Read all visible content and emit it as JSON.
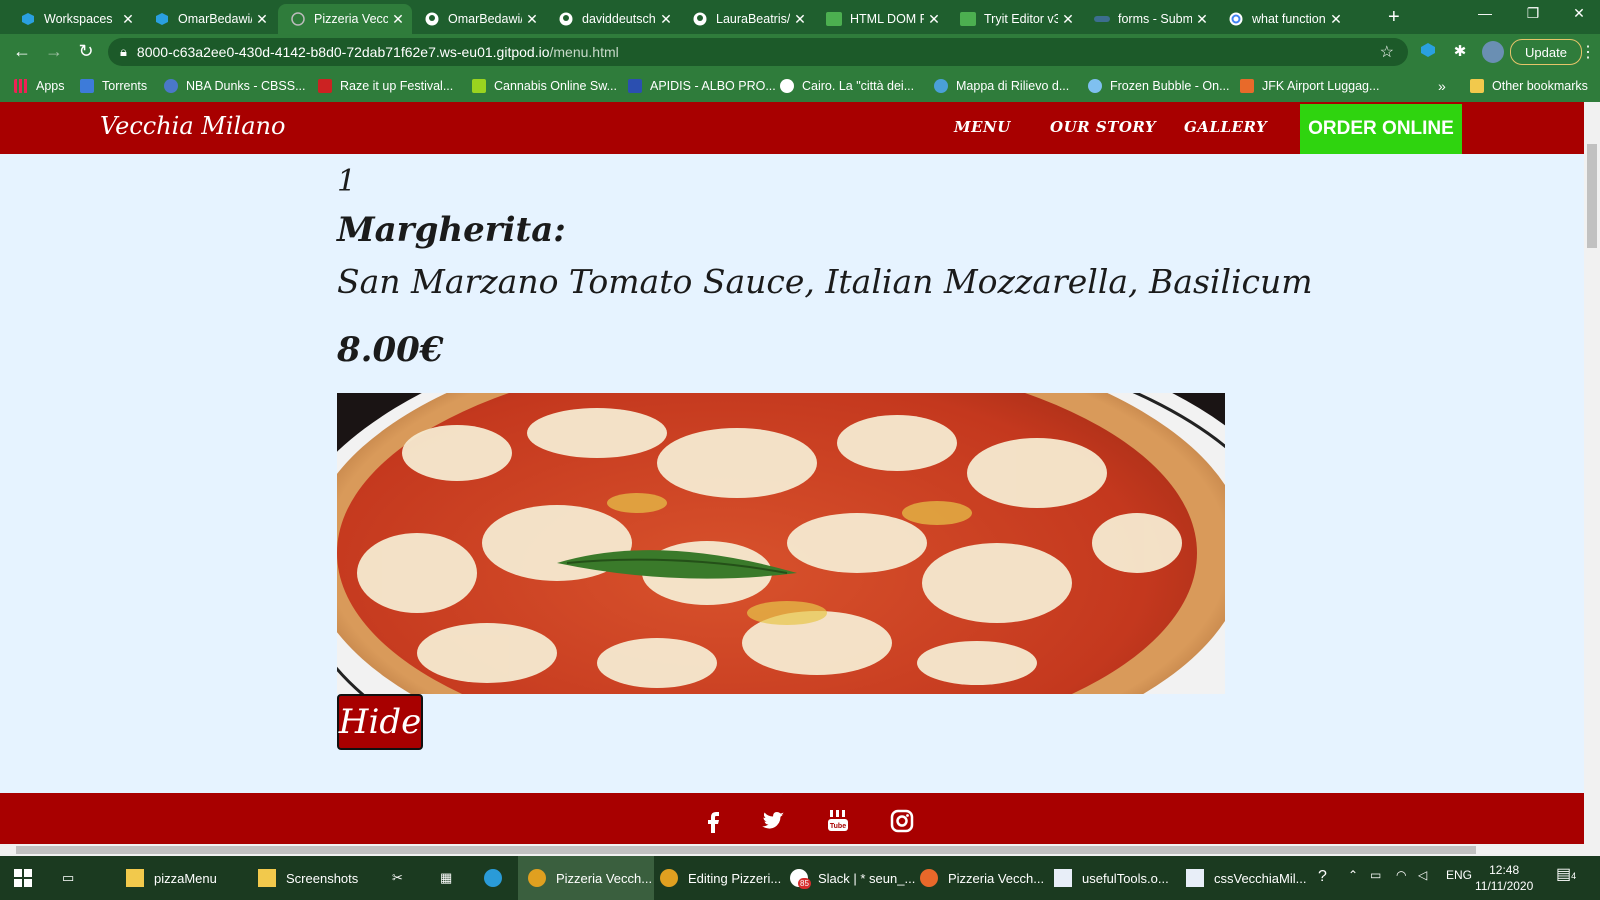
{
  "browser": {
    "tabs": [
      {
        "title": "Workspaces",
        "icon": "gitpod-icon"
      },
      {
        "title": "OmarBedawi/",
        "icon": "gitpod-icon"
      },
      {
        "title": "Pizzeria Vecch",
        "icon": "globe-icon"
      },
      {
        "title": "OmarBedawi/",
        "icon": "github-icon"
      },
      {
        "title": "daviddeutsch",
        "icon": "github-icon"
      },
      {
        "title": "LauraBeatris/",
        "icon": "github-icon"
      },
      {
        "title": "HTML DOM F",
        "icon": "w3schools-icon"
      },
      {
        "title": "Tryit Editor v3",
        "icon": "w3schools-icon"
      },
      {
        "title": "forms - Subm",
        "icon": "stackoverflow-icon"
      },
      {
        "title": "what function",
        "icon": "google-icon"
      }
    ],
    "active_tab_index": 2,
    "address": {
      "host": "8000-c63a2ee0-430d-4142-b8d0-72dab71f62e7.ws-eu01.gitpod.io",
      "path": "/menu.html"
    },
    "update_label": "Update",
    "bookmarks": [
      {
        "label": "Apps"
      },
      {
        "label": "Torrents"
      },
      {
        "label": "NBA Dunks - CBSS..."
      },
      {
        "label": "Raze it up Festival..."
      },
      {
        "label": "Cannabis Online Sw..."
      },
      {
        "label": "APIDIS - ALBO PRO..."
      },
      {
        "label": "Cairo. La \"città dei..."
      },
      {
        "label": "Mappa di Rilievo d..."
      },
      {
        "label": "Frozen Bubble - On..."
      },
      {
        "label": "JFK Airport Luggag..."
      }
    ],
    "bookmarks_overflow": "»",
    "other_bookmarks": "Other bookmarks"
  },
  "site": {
    "brand": "Vecchia Milano",
    "nav": [
      "MENU",
      "OUR STORY",
      "GALLERY"
    ],
    "order_button": "ORDER ONLINE",
    "accent_color": "#a80000",
    "order_color": "#2fd40f"
  },
  "menu_item": {
    "number": "1",
    "name": "Margherita:",
    "description": "San Marzano Tomato Sauce, Italian Mozzarella, Basilicum",
    "price": "8.00€",
    "image_alt": "margherita-pizza-photo",
    "hide_button": "Hide"
  },
  "footer": {
    "social": [
      "facebook-icon",
      "twitter-icon",
      "youtube-icon",
      "instagram-icon"
    ]
  },
  "taskbar": {
    "items": [
      {
        "label": "pizzaMenu"
      },
      {
        "label": "Screenshots"
      },
      {
        "label": "Pizzeria Vecch..."
      },
      {
        "label": "Editing Pizzeri..."
      },
      {
        "label": "Slack | * seun_..."
      },
      {
        "label": "Pizzeria Vecch..."
      },
      {
        "label": "usefulTools.o..."
      },
      {
        "label": "cssVecchiaMil..."
      }
    ],
    "slack_badge": "85",
    "language": "ENG",
    "time": "12:48",
    "date": "11/11/2020",
    "notifications": "4"
  }
}
